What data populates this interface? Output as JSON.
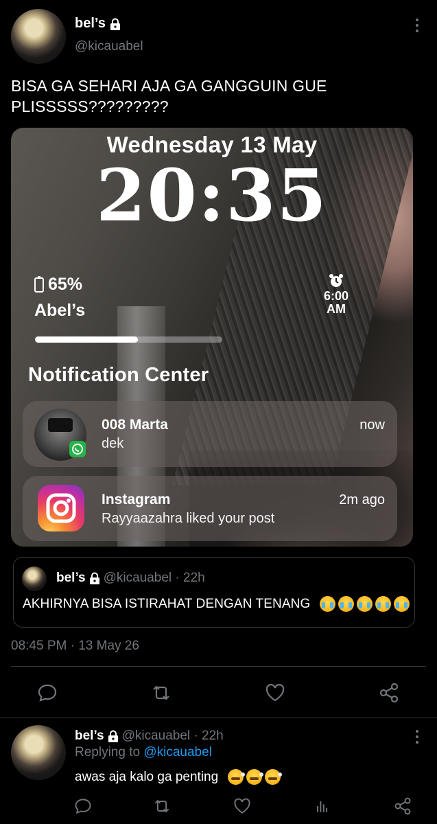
{
  "tweet": {
    "display_name": "bel’s",
    "handle": "@kicauabel",
    "text": "BISA GA SEHARI AJA GA GANGGUIN GUE PLISSSSS?????????",
    "timestamp": "08:45 PM · 13 May 26"
  },
  "lockscreen": {
    "date": "Wednesday 13 May",
    "time": "20:35",
    "battery": "65%",
    "device_name": "Abel’s",
    "alarm_time": "6:00",
    "alarm_period": "AM",
    "progress": 0.55,
    "notification_center_title": "Notification Center",
    "notifications": [
      {
        "app": "008 Marta",
        "body": "dek",
        "time": "now",
        "icon": "whatsapp-contact-avatar"
      },
      {
        "app": "Instagram",
        "body": "Rayyaazahra liked your post",
        "time": "2m ago",
        "icon": "instagram-icon"
      }
    ]
  },
  "quoted": {
    "display_name": "bel’s",
    "handle_time": "@kicauabel · 22h",
    "text": "AKHIRNYA BISA ISTIRAHAT DENGAN TENANG",
    "emoji": "loudly-crying-face",
    "emoji_count": 5
  },
  "actions": [
    "reply-icon",
    "retweet-icon",
    "like-icon",
    "share-icon"
  ],
  "reply": {
    "display_name": "bel’s",
    "handle_time": "@kicauabel · 22h",
    "replying_prefix": "Replying to",
    "replying_to": "@kicauabel",
    "text": "awas aja kalo ga penting",
    "emoji": "face-with-steam-from-nose",
    "emoji_count": 3
  },
  "colors": {
    "background": "#000000",
    "text": "#e7e9ea",
    "muted": "#71767b",
    "link": "#1d9bf0",
    "divider": "#2f3336"
  }
}
